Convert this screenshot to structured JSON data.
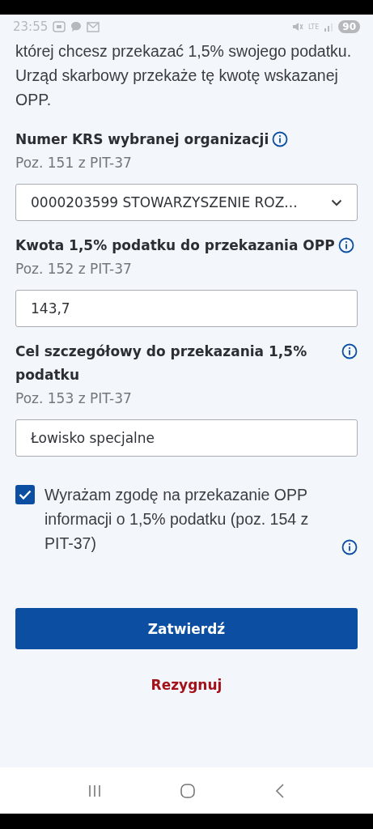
{
  "status_bar": {
    "time": "23:55",
    "network": "LTE",
    "battery": "90"
  },
  "intro": "której chcesz przekazać 1,5% swojego podatku. Urząd skarbowy przekaże tę kwotę wskazanej OPP.",
  "fields": [
    {
      "kind": "select",
      "label": "Numer KRS wybranej organizacji",
      "hint": "Poz. 151 z PIT-37",
      "value": "0000203599 STOWARZYSZENIE ROZ..."
    },
    {
      "kind": "input",
      "label": "Kwota 1,5% podatku do przekazania OPP",
      "hint": "Poz. 152 z PIT-37",
      "value": "143,7"
    },
    {
      "kind": "input",
      "label": "Cel szczegółowy do przekazania 1,5% podatku",
      "hint": "Poz. 153 z PIT-37",
      "value": "Łowisko specjalne"
    }
  ],
  "consent": {
    "checked": true,
    "text": "Wyrażam zgodę na przekazanie OPP informacji o 1,5% podatku (poz. 154 z PIT-37)"
  },
  "buttons": {
    "confirm": "Zatwierdź",
    "cancel": "Rezygnuj"
  }
}
